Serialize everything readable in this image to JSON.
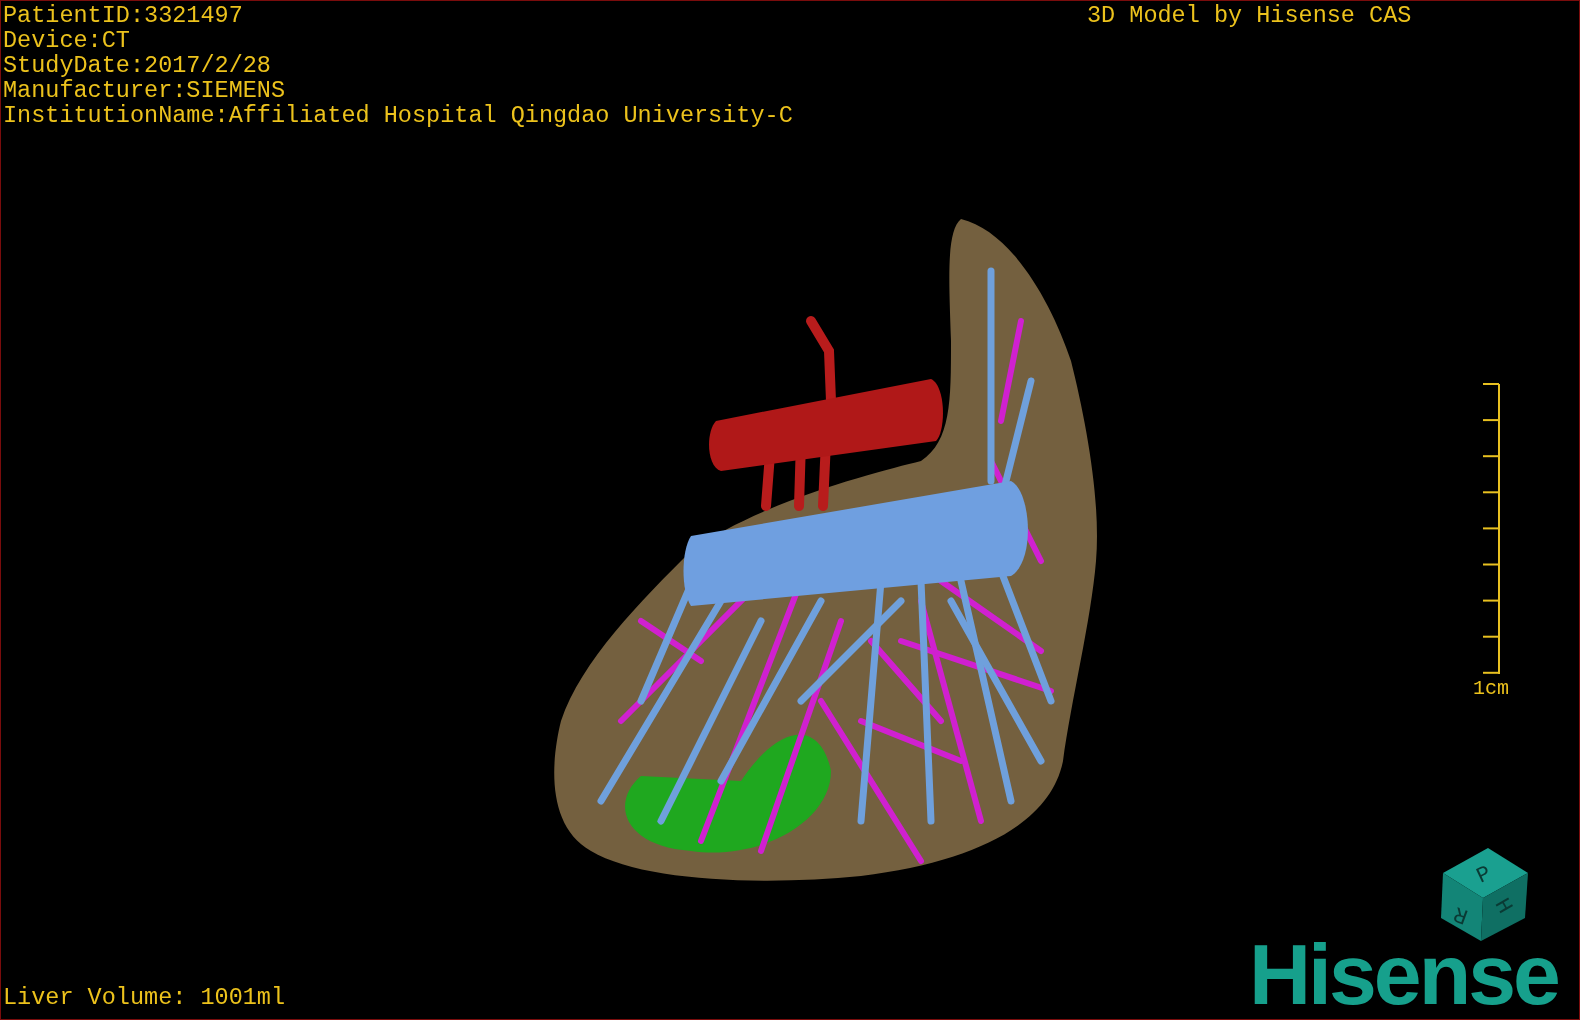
{
  "patient_info": [
    "PatientID:3321497",
    "Device:CT",
    "StudyDate:2017/2/28",
    "Manufacturer:SIEMENS",
    "InstitutionName:Affiliated Hospital Qingdao University-C"
  ],
  "model_credit": "3D Model by Hisense CAS",
  "scale_bar": {
    "label": "1cm"
  },
  "orientation_cube": {
    "faces": [
      "P",
      "H",
      "R"
    ]
  },
  "logo": "Hisense",
  "liver_volume": "Liver Volume: 1001ml"
}
